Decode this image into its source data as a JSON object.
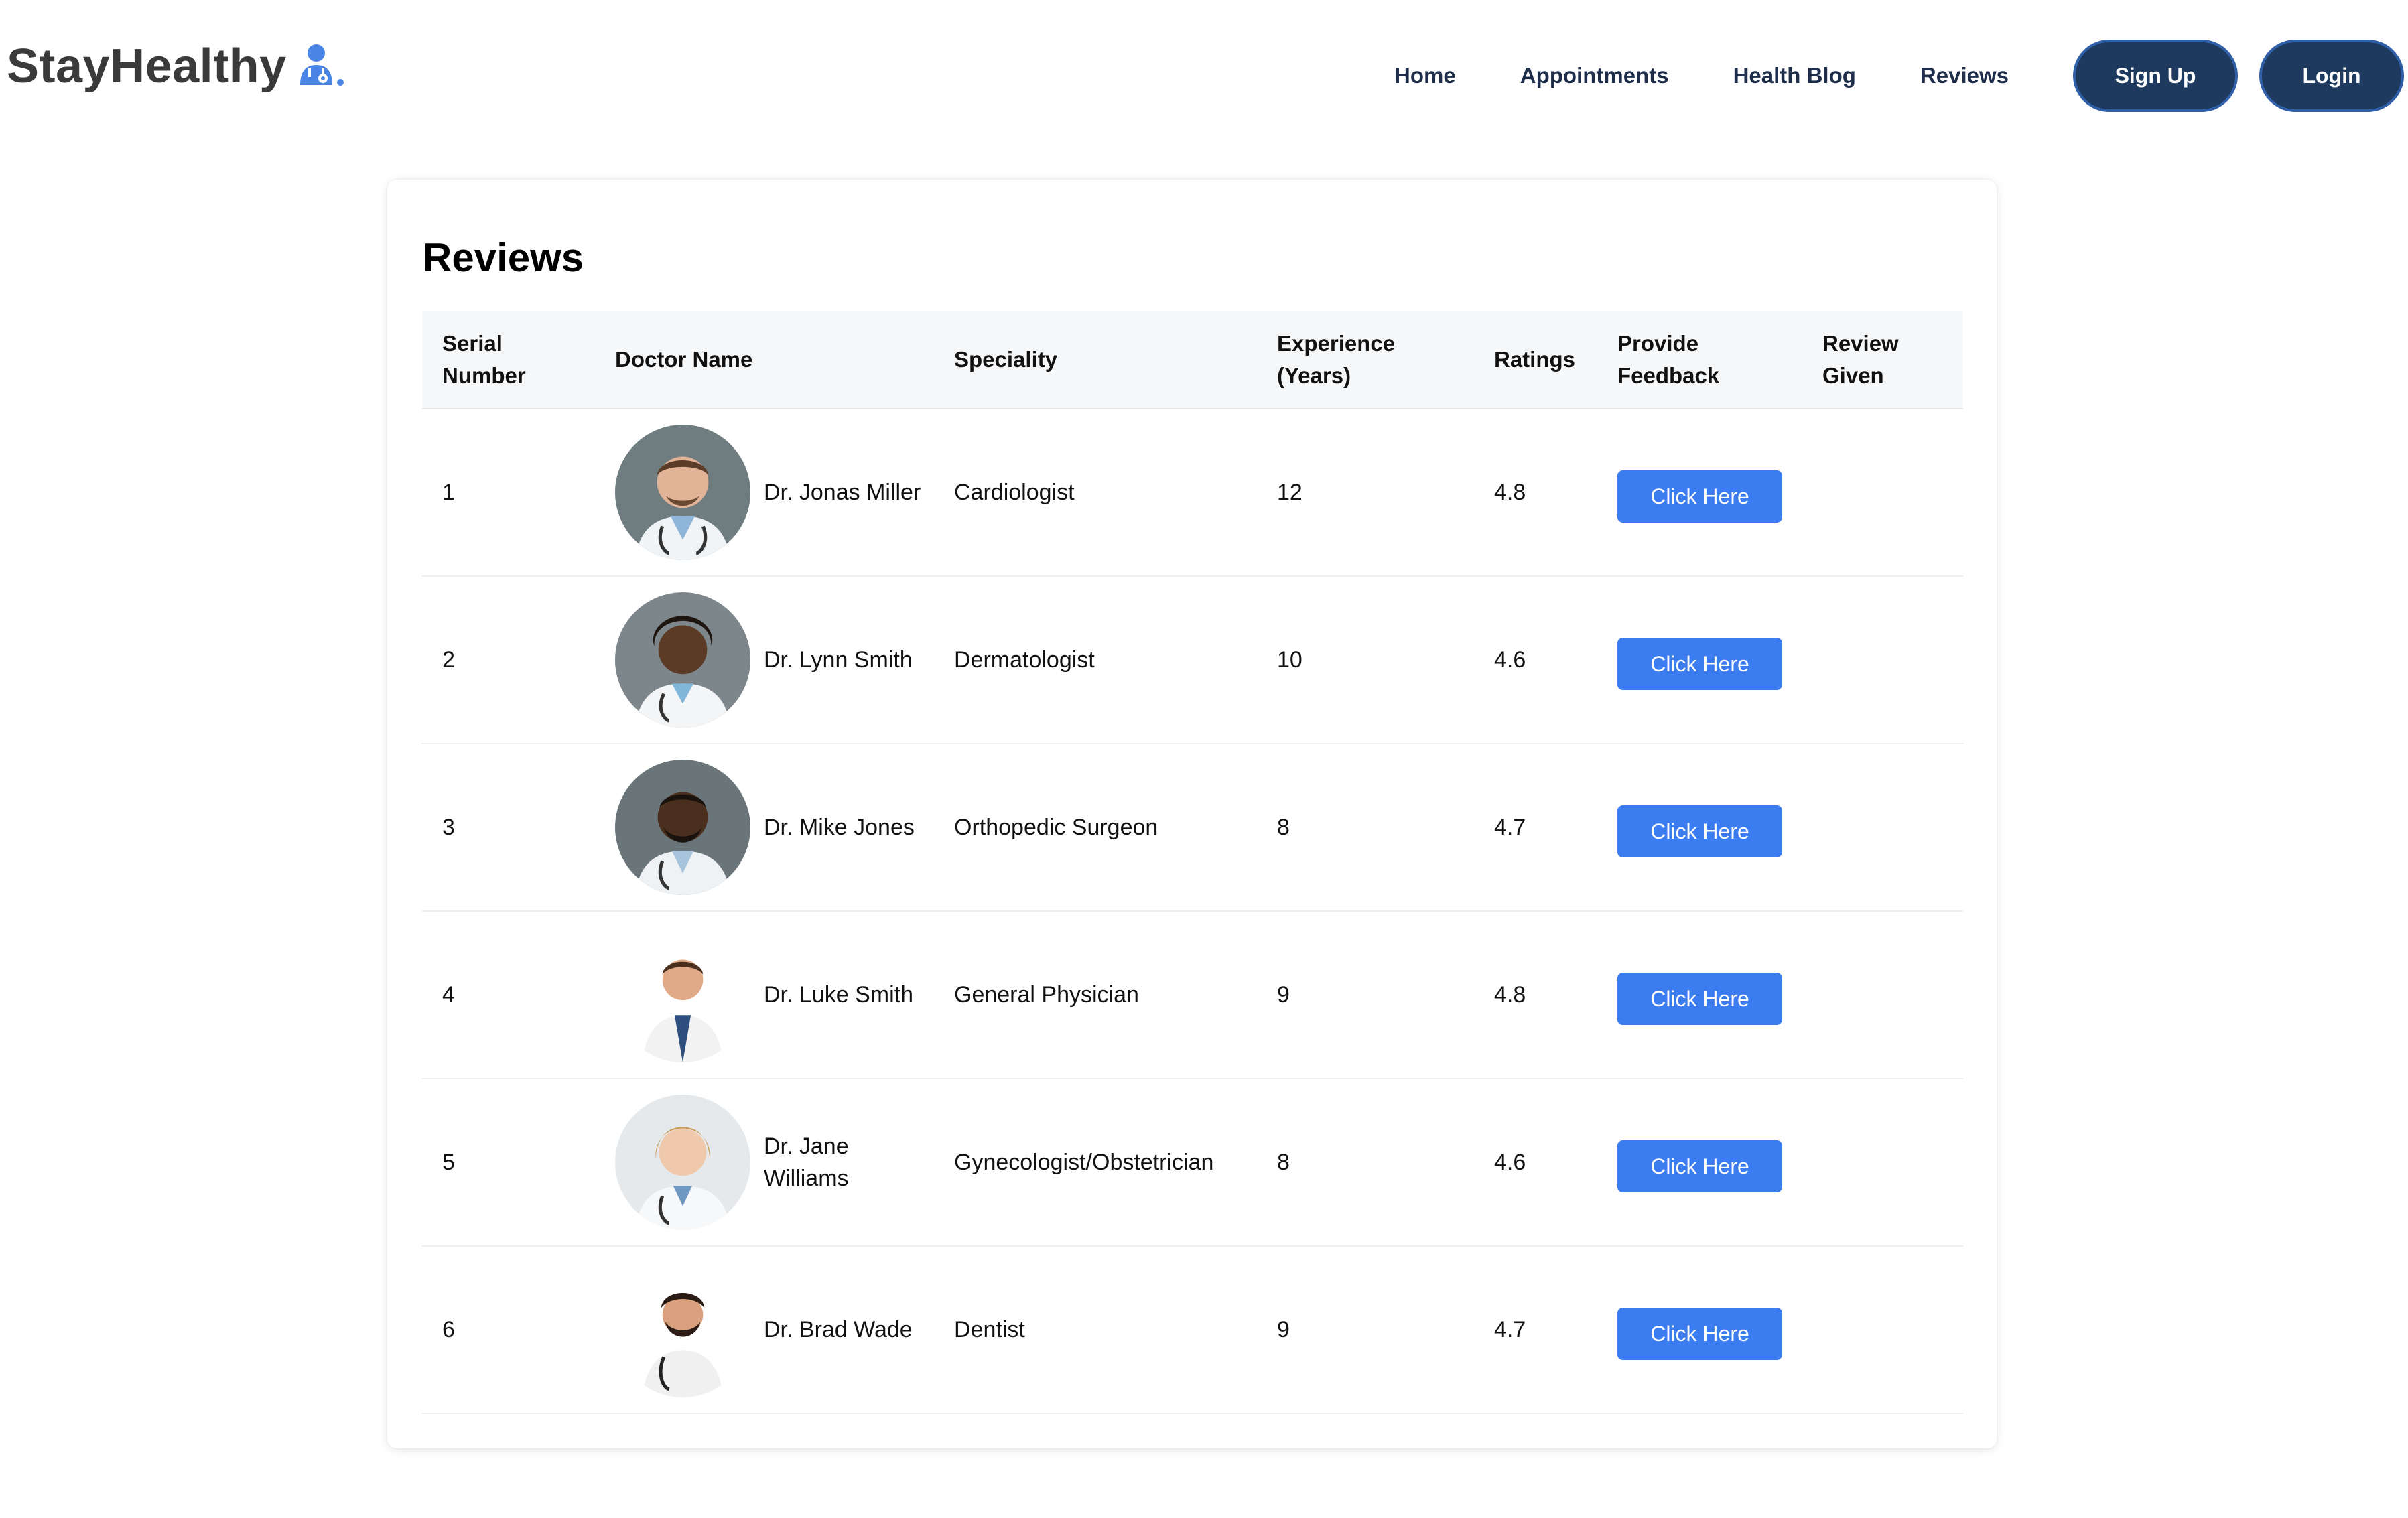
{
  "brand": {
    "name": "StayHealthy",
    "icon": "doctor-logo-icon",
    "color": "#3a3a3a",
    "icon_color": "#4a85e6"
  },
  "nav": {
    "links": [
      "Home",
      "Appointments",
      "Health Blog",
      "Reviews"
    ],
    "signup_label": "Sign Up",
    "login_label": "Login"
  },
  "page": {
    "title": "Reviews",
    "columns": [
      "Serial Number",
      "Doctor Name",
      "Speciality",
      "Experience (Years)",
      "Ratings",
      "Provide Feedback",
      "Review Given"
    ],
    "rows": [
      {
        "serial": "1",
        "name": "Dr. Jonas Miller",
        "speciality": "Cardiologist",
        "experience": "12",
        "rating": "4.8",
        "feedback_label": "Click Here",
        "review": ""
      },
      {
        "serial": "2",
        "name": "Dr. Lynn Smith",
        "speciality": "Dermatologist",
        "experience": "10",
        "rating": "4.6",
        "feedback_label": "Click Here",
        "review": ""
      },
      {
        "serial": "3",
        "name": "Dr. Mike Jones",
        "speciality": "Orthopedic Surgeon",
        "experience": "8",
        "rating": "4.7",
        "feedback_label": "Click Here",
        "review": ""
      },
      {
        "serial": "4",
        "name": "Dr. Luke Smith",
        "speciality": "General Physician",
        "experience": "9",
        "rating": "4.8",
        "feedback_label": "Click Here",
        "review": ""
      },
      {
        "serial": "5",
        "name": "Dr. Jane Williams",
        "speciality": "Gynecologist/Obstetrician",
        "experience": "8",
        "rating": "4.6",
        "feedback_label": "Click Here",
        "review": ""
      },
      {
        "serial": "6",
        "name": "Dr. Brad Wade",
        "speciality": "Dentist",
        "experience": "9",
        "rating": "4.7",
        "feedback_label": "Click Here",
        "review": ""
      }
    ]
  },
  "colors": {
    "nav_button": "#1e3a5f",
    "action_button": "#3b7cf0"
  }
}
